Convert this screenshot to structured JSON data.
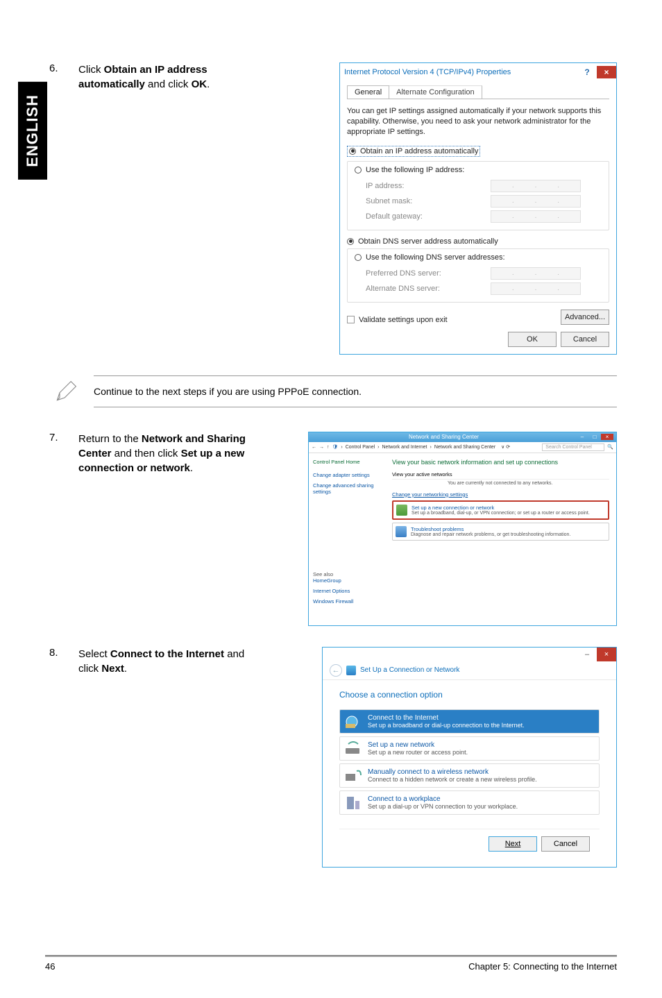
{
  "sideTab": "ENGLISH",
  "step6": {
    "num": "6.",
    "text_pre": "Click ",
    "bold1": "Obtain an IP address automatically",
    "text_mid": " and click ",
    "bold2": "OK",
    "text_post": "."
  },
  "ipv4": {
    "title": "Internet Protocol Version 4 (TCP/IPv4) Properties",
    "help": "?",
    "close": "×",
    "tab_general": "General",
    "tab_alt": "Alternate Configuration",
    "note": "You can get IP settings assigned automatically if your network supports this capability. Otherwise, you need to ask your network administrator for the appropriate IP settings.",
    "r_obtain_ip": "Obtain an IP address automatically",
    "r_use_ip": "Use the following IP address:",
    "f_ip": "IP address:",
    "f_subnet": "Subnet mask:",
    "f_gateway": "Default gateway:",
    "r_obtain_dns": "Obtain DNS server address automatically",
    "r_use_dns": "Use the following DNS server addresses:",
    "f_pref_dns": "Preferred DNS server:",
    "f_alt_dns": "Alternate DNS server:",
    "chk_validate": "Validate settings upon exit",
    "btn_adv": "Advanced...",
    "btn_ok": "OK",
    "btn_cancel": "Cancel"
  },
  "note": {
    "text": "Continue to the next steps if you are using PPPoE connection."
  },
  "step7": {
    "num": "7.",
    "pre": "Return to the ",
    "b1": "Network and Sharing Center",
    "mid": " and then click ",
    "b2": "Set up a new connection or network",
    "post": "."
  },
  "nscenter": {
    "wintitle": "Network and Sharing Center",
    "crumb1": "Control Panel",
    "crumb2": "Network and Internet",
    "crumb3": "Network and Sharing Center",
    "search_ph": "Search Control Panel",
    "side_home": "Control Panel Home",
    "side_l1": "Change adapter settings",
    "side_l2": "Change advanced sharing settings",
    "seealso": "See also",
    "sa1": "HomeGroup",
    "sa2": "Internet Options",
    "sa3": "Windows Firewall",
    "h1": "View your basic network information and set up connections",
    "view_active": "View your active networks",
    "not_connected": "You are currently not connected to any networks.",
    "change_net": "Change your networking settings",
    "box1_t": "Set up a new connection or network",
    "box1_d": "Set up a broadband, dial-up, or VPN connection; or set up a router or access point.",
    "box2_t": "Troubleshoot problems",
    "box2_d": "Diagnose and repair network problems, or get troubleshooting information."
  },
  "step8": {
    "num": "8.",
    "pre": "Select ",
    "b1": "Connect to the Internet",
    "mid": " and click ",
    "b2": "Next",
    "post": "."
  },
  "wizard": {
    "min": "–",
    "close": "×",
    "head": "Set Up a Connection or Network",
    "h": "Choose a connection option",
    "o1_t": "Connect to the Internet",
    "o1_d": "Set up a broadband or dial-up connection to the Internet.",
    "o2_t": "Set up a new network",
    "o2_d": "Set up a new router or access point.",
    "o3_t": "Manually connect to a wireless network",
    "o3_d": "Connect to a hidden network or create a new wireless profile.",
    "o4_t": "Connect to a workplace",
    "o4_d": "Set up a dial-up or VPN connection to your workplace.",
    "btn_next": "Next",
    "btn_cancel": "Cancel"
  },
  "footer": {
    "pagenum": "46",
    "chapter": "Chapter 5: Connecting to the Internet"
  }
}
